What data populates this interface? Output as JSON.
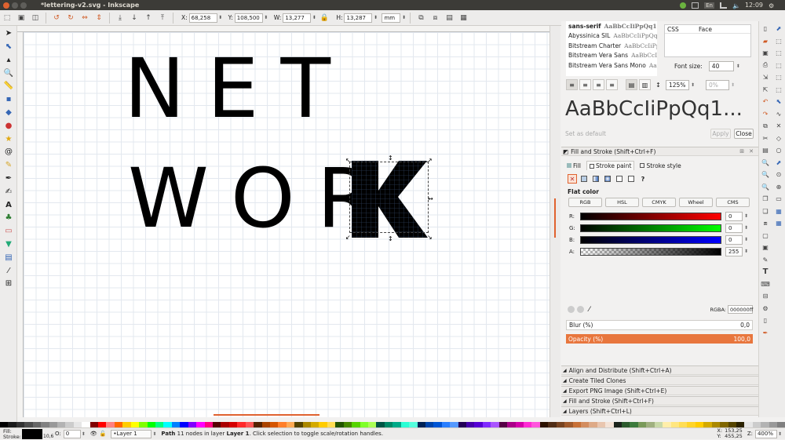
{
  "window": {
    "title": "*lettering-v2.svg - Inkscape"
  },
  "system_tray": {
    "keyboard": "En",
    "clock": "12:09"
  },
  "tool_controls": {
    "x_label": "X:",
    "x_value": "68,258",
    "y_label": "Y:",
    "y_value": "108,500",
    "w_label": "W:",
    "w_value": "13,277",
    "h_label": "H:",
    "h_value": "13,287",
    "unit": "mm"
  },
  "canvas": {
    "line1": "NET",
    "line2": "WOR",
    "selected_glyph": "K"
  },
  "text_panel": {
    "fonts": [
      {
        "name": "sans-serif",
        "sample": "AaBbCcIiPpQq1234"
      },
      {
        "name": "Abyssinica SIL",
        "sample": "AaBbCcIiPpQq12"
      },
      {
        "name": "Bitstream Charter",
        "sample": "AaBbCcIiPpQ"
      },
      {
        "name": "Bitstream Vera Sans",
        "sample": "AaBbCcIiP"
      },
      {
        "name": "Bitstream Vera Sans Mono",
        "sample": "AaB"
      }
    ],
    "css_col": "CSS",
    "face_col": "Face",
    "font_size_label": "Font size:",
    "font_size_value": "40",
    "line_spacing": "125%",
    "letter_spacing": "0%",
    "preview": "AaBbCcIiPpQq1...",
    "set_default": "Set as default",
    "apply": "Apply",
    "close": "Close"
  },
  "fill_stroke": {
    "title": "Fill and Stroke (Shift+Ctrl+F)",
    "tabs": [
      "Fill",
      "Stroke paint",
      "Stroke style"
    ],
    "flat_color_label": "Flat color",
    "modes": [
      "RGB",
      "HSL",
      "CMYK",
      "Wheel",
      "CMS"
    ],
    "channels": [
      {
        "label": "R:",
        "value": "0"
      },
      {
        "label": "G:",
        "value": "0"
      },
      {
        "label": "B:",
        "value": "0"
      },
      {
        "label": "A:",
        "value": "255"
      }
    ],
    "rgba_label": "RGBA:",
    "rgba_value": "000000ff",
    "blur_label": "Blur (%)",
    "blur_value": "0,0",
    "opacity_label": "Opacity (%)",
    "opacity_value": "100,0",
    "accent": "#e8763d"
  },
  "docked_dialogs": [
    "Align and Distribute (Shift+Ctrl+A)",
    "Create Tiled Clones",
    "Export PNG Image (Shift+Ctrl+E)",
    "Fill and Stroke (Shift+Ctrl+F)",
    "Layers (Shift+Ctrl+L)"
  ],
  "statusbar": {
    "fill_label": "Fill:",
    "stroke_label": "Stroke:",
    "stroke_width": "10,6",
    "opacity_label": "O:",
    "opacity_value": "0",
    "layer": "•Layer 1",
    "message_bold": "Path",
    "message_mid": " 11 nodes in layer ",
    "message_layer": "Layer 1",
    "message_tail": ". Click selection to toggle scale/rotation handles.",
    "x_label": "X:",
    "x_value": "153,25",
    "y_label": "Y:",
    "y_value": "455,25",
    "zoom_label": "Z:",
    "zoom_value": "400%"
  }
}
